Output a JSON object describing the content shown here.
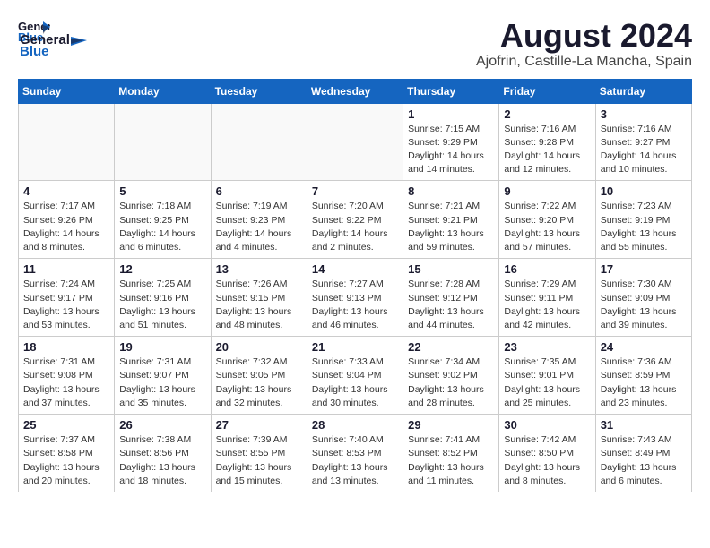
{
  "header": {
    "logo_general": "General",
    "logo_blue": "Blue",
    "title": "August 2024",
    "subtitle": "Ajofrin, Castille-La Mancha, Spain"
  },
  "calendar": {
    "weekdays": [
      "Sunday",
      "Monday",
      "Tuesday",
      "Wednesday",
      "Thursday",
      "Friday",
      "Saturday"
    ],
    "weeks": [
      [
        {
          "day": "",
          "info": ""
        },
        {
          "day": "",
          "info": ""
        },
        {
          "day": "",
          "info": ""
        },
        {
          "day": "",
          "info": ""
        },
        {
          "day": "1",
          "info": "Sunrise: 7:15 AM\nSunset: 9:29 PM\nDaylight: 14 hours and 14 minutes."
        },
        {
          "day": "2",
          "info": "Sunrise: 7:16 AM\nSunset: 9:28 PM\nDaylight: 14 hours and 12 minutes."
        },
        {
          "day": "3",
          "info": "Sunrise: 7:16 AM\nSunset: 9:27 PM\nDaylight: 14 hours and 10 minutes."
        }
      ],
      [
        {
          "day": "4",
          "info": "Sunrise: 7:17 AM\nSunset: 9:26 PM\nDaylight: 14 hours and 8 minutes."
        },
        {
          "day": "5",
          "info": "Sunrise: 7:18 AM\nSunset: 9:25 PM\nDaylight: 14 hours and 6 minutes."
        },
        {
          "day": "6",
          "info": "Sunrise: 7:19 AM\nSunset: 9:23 PM\nDaylight: 14 hours and 4 minutes."
        },
        {
          "day": "7",
          "info": "Sunrise: 7:20 AM\nSunset: 9:22 PM\nDaylight: 14 hours and 2 minutes."
        },
        {
          "day": "8",
          "info": "Sunrise: 7:21 AM\nSunset: 9:21 PM\nDaylight: 13 hours and 59 minutes."
        },
        {
          "day": "9",
          "info": "Sunrise: 7:22 AM\nSunset: 9:20 PM\nDaylight: 13 hours and 57 minutes."
        },
        {
          "day": "10",
          "info": "Sunrise: 7:23 AM\nSunset: 9:19 PM\nDaylight: 13 hours and 55 minutes."
        }
      ],
      [
        {
          "day": "11",
          "info": "Sunrise: 7:24 AM\nSunset: 9:17 PM\nDaylight: 13 hours and 53 minutes."
        },
        {
          "day": "12",
          "info": "Sunrise: 7:25 AM\nSunset: 9:16 PM\nDaylight: 13 hours and 51 minutes."
        },
        {
          "day": "13",
          "info": "Sunrise: 7:26 AM\nSunset: 9:15 PM\nDaylight: 13 hours and 48 minutes."
        },
        {
          "day": "14",
          "info": "Sunrise: 7:27 AM\nSunset: 9:13 PM\nDaylight: 13 hours and 46 minutes."
        },
        {
          "day": "15",
          "info": "Sunrise: 7:28 AM\nSunset: 9:12 PM\nDaylight: 13 hours and 44 minutes."
        },
        {
          "day": "16",
          "info": "Sunrise: 7:29 AM\nSunset: 9:11 PM\nDaylight: 13 hours and 42 minutes."
        },
        {
          "day": "17",
          "info": "Sunrise: 7:30 AM\nSunset: 9:09 PM\nDaylight: 13 hours and 39 minutes."
        }
      ],
      [
        {
          "day": "18",
          "info": "Sunrise: 7:31 AM\nSunset: 9:08 PM\nDaylight: 13 hours and 37 minutes."
        },
        {
          "day": "19",
          "info": "Sunrise: 7:31 AM\nSunset: 9:07 PM\nDaylight: 13 hours and 35 minutes."
        },
        {
          "day": "20",
          "info": "Sunrise: 7:32 AM\nSunset: 9:05 PM\nDaylight: 13 hours and 32 minutes."
        },
        {
          "day": "21",
          "info": "Sunrise: 7:33 AM\nSunset: 9:04 PM\nDaylight: 13 hours and 30 minutes."
        },
        {
          "day": "22",
          "info": "Sunrise: 7:34 AM\nSunset: 9:02 PM\nDaylight: 13 hours and 28 minutes."
        },
        {
          "day": "23",
          "info": "Sunrise: 7:35 AM\nSunset: 9:01 PM\nDaylight: 13 hours and 25 minutes."
        },
        {
          "day": "24",
          "info": "Sunrise: 7:36 AM\nSunset: 8:59 PM\nDaylight: 13 hours and 23 minutes."
        }
      ],
      [
        {
          "day": "25",
          "info": "Sunrise: 7:37 AM\nSunset: 8:58 PM\nDaylight: 13 hours and 20 minutes."
        },
        {
          "day": "26",
          "info": "Sunrise: 7:38 AM\nSunset: 8:56 PM\nDaylight: 13 hours and 18 minutes."
        },
        {
          "day": "27",
          "info": "Sunrise: 7:39 AM\nSunset: 8:55 PM\nDaylight: 13 hours and 15 minutes."
        },
        {
          "day": "28",
          "info": "Sunrise: 7:40 AM\nSunset: 8:53 PM\nDaylight: 13 hours and 13 minutes."
        },
        {
          "day": "29",
          "info": "Sunrise: 7:41 AM\nSunset: 8:52 PM\nDaylight: 13 hours and 11 minutes."
        },
        {
          "day": "30",
          "info": "Sunrise: 7:42 AM\nSunset: 8:50 PM\nDaylight: 13 hours and 8 minutes."
        },
        {
          "day": "31",
          "info": "Sunrise: 7:43 AM\nSunset: 8:49 PM\nDaylight: 13 hours and 6 minutes."
        }
      ]
    ]
  }
}
